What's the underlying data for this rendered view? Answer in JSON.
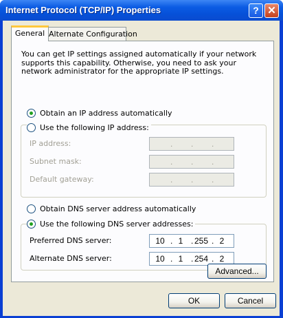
{
  "window": {
    "title": "Internet Protocol (TCP/IP) Properties",
    "help_glyph": "?",
    "close_glyph": "✕"
  },
  "tabs": [
    {
      "label": "General",
      "active": true
    },
    {
      "label": "Alternate Configuration",
      "active": false
    }
  ],
  "description": "You can get IP settings assigned automatically if your network supports this capability. Otherwise, you need to ask your network administrator for the appropriate IP settings.",
  "ip": {
    "auto_label": "Obtain an IP address automatically",
    "auto_selected": true,
    "manual_label": "Use the following IP address:",
    "manual_selected": false,
    "fields": [
      {
        "label": "IP address:",
        "segments": [
          "",
          "",
          "",
          ""
        ],
        "disabled": true
      },
      {
        "label": "Subnet mask:",
        "segments": [
          "",
          "",
          "",
          ""
        ],
        "disabled": true
      },
      {
        "label": "Default gateway:",
        "segments": [
          "",
          "",
          "",
          ""
        ],
        "disabled": true
      }
    ]
  },
  "dns": {
    "auto_label": "Obtain DNS server address automatically",
    "auto_selected": false,
    "manual_label": "Use the following DNS server addresses:",
    "manual_selected": true,
    "fields": [
      {
        "label": "Preferred DNS server:",
        "segments": [
          "10",
          "1",
          "255",
          "2"
        ],
        "disabled": false
      },
      {
        "label": "Alternate DNS server:",
        "segments": [
          "10",
          "1",
          "254",
          "2"
        ],
        "disabled": false
      }
    ]
  },
  "buttons": {
    "advanced": "Advanced...",
    "ok": "OK",
    "cancel": "Cancel"
  },
  "colors": {
    "titlebar": "#0650d8",
    "dialog_face": "#ece9d8",
    "tab_highlight": "#ffc83c",
    "radio_selected": "#21a121"
  }
}
